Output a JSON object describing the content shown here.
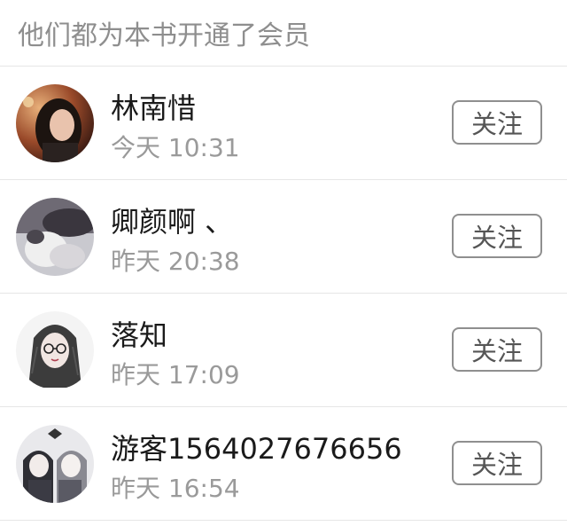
{
  "header": {
    "title": "他们都为本书开通了会员"
  },
  "members": [
    {
      "name": "林南惜",
      "time": "今天 10:31",
      "follow_label": "关注",
      "avatar": "avatar-photo-woman"
    },
    {
      "name": "卿颜啊 、",
      "time": "昨天 20:38",
      "follow_label": "关注",
      "avatar": "avatar-photo-cat"
    },
    {
      "name": "落知",
      "time": "昨天 17:09",
      "follow_label": "关注",
      "avatar": "avatar-illustration-girl-glasses"
    },
    {
      "name": "游客1564027676656",
      "time": "昨天 16:54",
      "follow_label": "关注",
      "avatar": "avatar-illustration-two-girls"
    }
  ]
}
